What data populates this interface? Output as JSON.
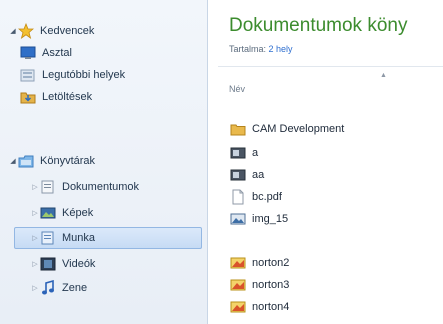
{
  "nav": {
    "favorites": {
      "label": "Kedvencek",
      "items": [
        {
          "label": "Asztal",
          "icon": "desktop-icon"
        },
        {
          "label": "Legutóbbi helyek",
          "icon": "recent-places-icon"
        },
        {
          "label": "Letöltések",
          "icon": "downloads-folder-icon"
        }
      ]
    },
    "libraries": {
      "label": "Könyvtárak",
      "items": [
        {
          "label": "Dokumentumok",
          "icon": "documents-library-icon"
        },
        {
          "label": "Képek",
          "icon": "pictures-library-icon"
        },
        {
          "label": "Munka",
          "icon": "work-library-icon",
          "selected": true
        },
        {
          "label": "Videók",
          "icon": "videos-library-icon"
        },
        {
          "label": "Zene",
          "icon": "music-library-icon"
        }
      ]
    }
  },
  "main": {
    "title": "Dokumentumok köny",
    "subtitle_key": "Tartalma:",
    "subtitle_value": "2 hely",
    "column_name": "Név",
    "files": [
      {
        "name": "CAM Development",
        "icon": "folder-icon"
      },
      {
        "name": "a",
        "icon": "image-file-icon"
      },
      {
        "name": "aa",
        "icon": "image-file-icon"
      },
      {
        "name": "bc.pdf",
        "icon": "pdf-file-icon"
      },
      {
        "name": "img_15",
        "icon": "picture-file-icon"
      },
      {
        "name": "norton2",
        "icon": "norton-file-icon"
      },
      {
        "name": "norton3",
        "icon": "norton-file-icon"
      },
      {
        "name": "norton4",
        "icon": "norton-file-icon"
      }
    ]
  },
  "colors": {
    "title_green": "#3c8c2e",
    "link_blue": "#2f6fd0",
    "selection_bg": "#c6dbf4"
  }
}
